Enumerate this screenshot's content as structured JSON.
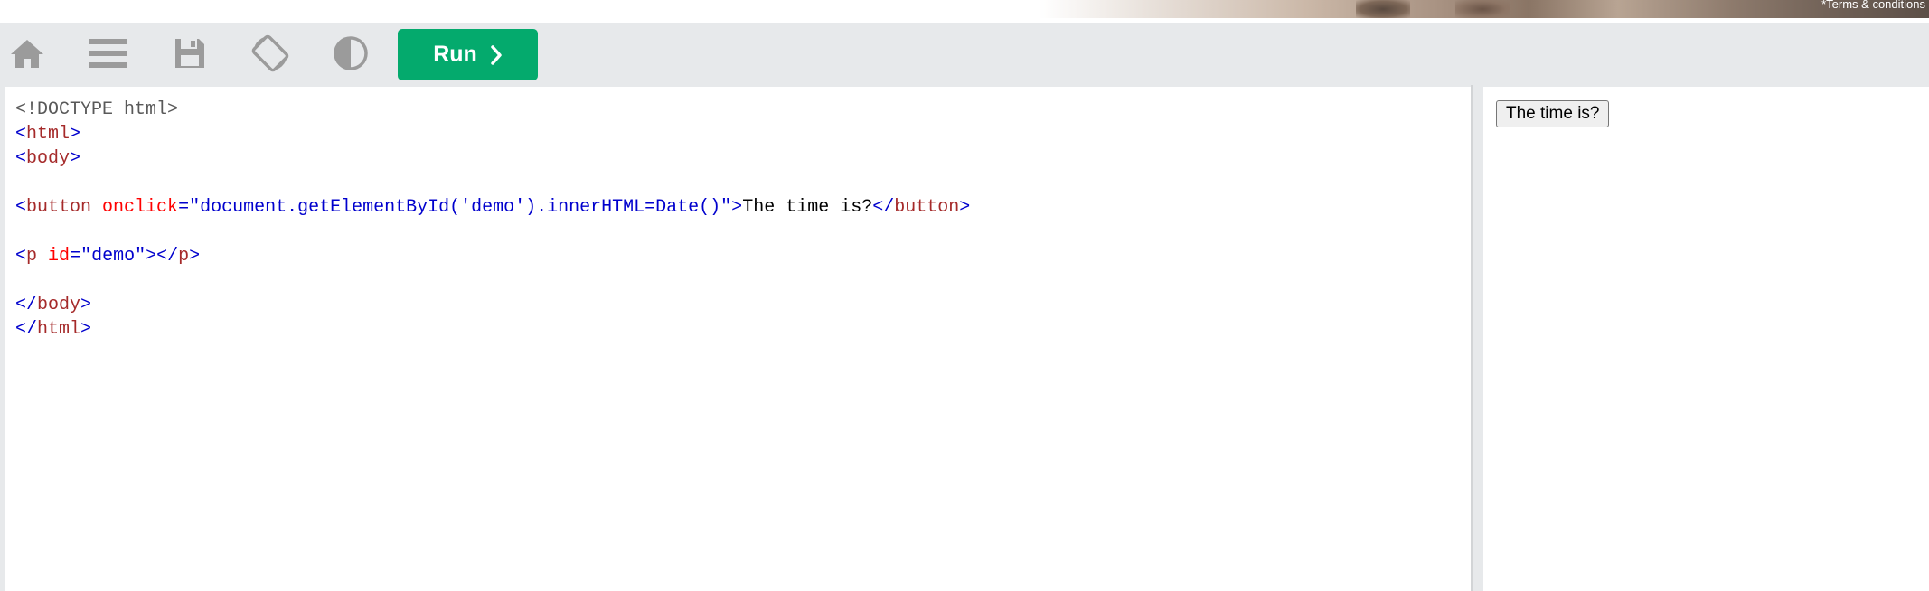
{
  "ad": {
    "terms_text": "*Terms & conditions"
  },
  "toolbar": {
    "icons": [
      "home-icon",
      "menu-icon",
      "save-icon",
      "rotate-icon",
      "contrast-icon"
    ],
    "run_label": "Run",
    "run_color": "#04aa6d",
    "background_color": "#e7e9eb"
  },
  "editor": {
    "lines": [
      [
        {
          "c": "doc",
          "t": "<!DOCTYPE html>"
        }
      ],
      [
        {
          "c": "brk",
          "t": "<"
        },
        {
          "c": "tag",
          "t": "html"
        },
        {
          "c": "brk",
          "t": ">"
        }
      ],
      [
        {
          "c": "brk",
          "t": "<"
        },
        {
          "c": "tag",
          "t": "body"
        },
        {
          "c": "brk",
          "t": ">"
        }
      ],
      [],
      [
        {
          "c": "brk",
          "t": "<"
        },
        {
          "c": "tag",
          "t": "button"
        },
        {
          "c": "txt",
          "t": " "
        },
        {
          "c": "attr",
          "t": "onclick"
        },
        {
          "c": "val",
          "t": "=\"document.getElementById('demo').innerHTML=Date()\""
        },
        {
          "c": "brk",
          "t": ">"
        },
        {
          "c": "txt",
          "t": "The time is?"
        },
        {
          "c": "brk",
          "t": "</"
        },
        {
          "c": "tag",
          "t": "button"
        },
        {
          "c": "brk",
          "t": ">"
        }
      ],
      [],
      [
        {
          "c": "brk",
          "t": "<"
        },
        {
          "c": "tag",
          "t": "p"
        },
        {
          "c": "txt",
          "t": " "
        },
        {
          "c": "attr",
          "t": "id"
        },
        {
          "c": "val",
          "t": "=\"demo\""
        },
        {
          "c": "brk",
          "t": "></"
        },
        {
          "c": "tag",
          "t": "p"
        },
        {
          "c": "brk",
          "t": ">"
        }
      ],
      [],
      [
        {
          "c": "brk",
          "t": "</"
        },
        {
          "c": "tag",
          "t": "body"
        },
        {
          "c": "brk",
          "t": ">"
        }
      ],
      [
        {
          "c": "brk",
          "t": "</"
        },
        {
          "c": "tag",
          "t": "html"
        },
        {
          "c": "brk",
          "t": ">"
        }
      ]
    ],
    "colors": {
      "tag": "#a52a2a",
      "bracket": "#0000cd",
      "attribute": "#ff0000",
      "value": "#0000cd",
      "doctype": "#595959"
    }
  },
  "preview": {
    "button_label": "The time is?"
  }
}
